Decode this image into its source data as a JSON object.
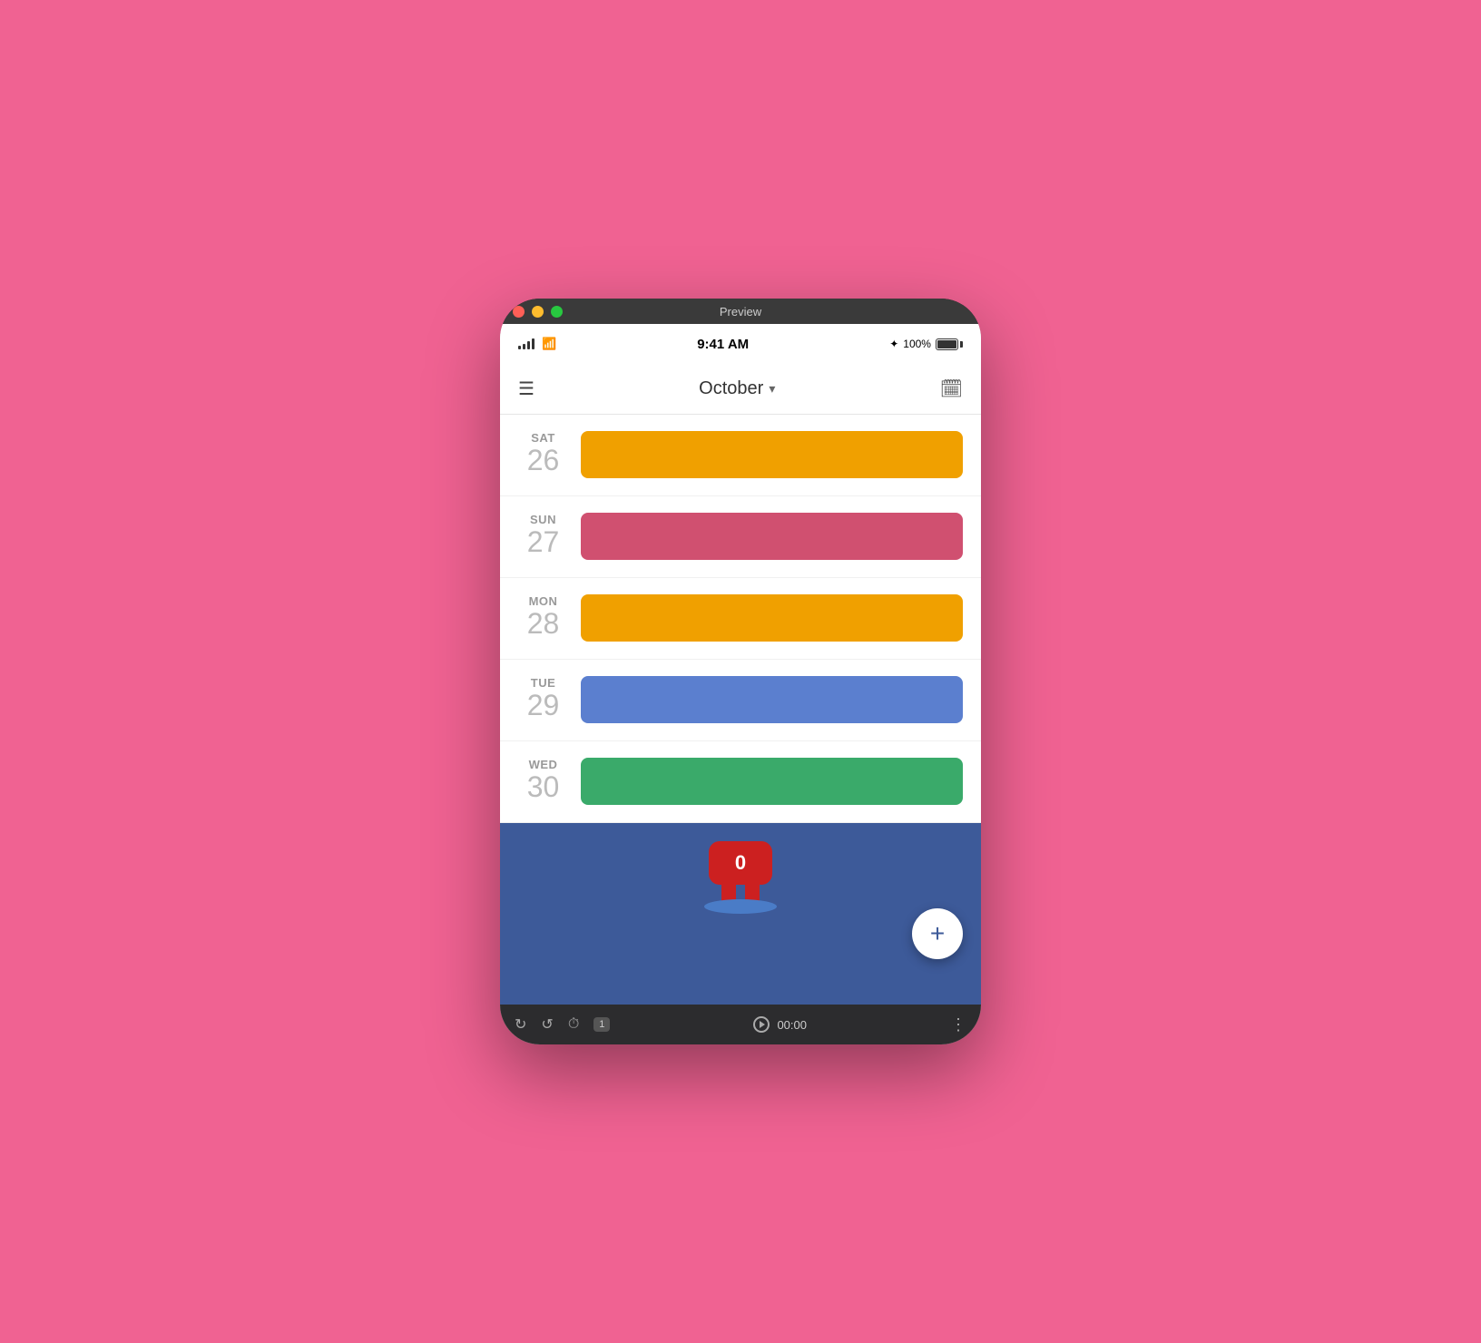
{
  "window": {
    "title": "Preview",
    "mac_buttons": [
      "close",
      "minimize",
      "maximize"
    ]
  },
  "status_bar": {
    "time": "9:41 AM",
    "battery_percent": "100%",
    "bluetooth": "BT"
  },
  "header": {
    "month": "October",
    "hamburger_label": "☰",
    "calendar_icon": "📅",
    "dropdown_arrow": "▾"
  },
  "days": [
    {
      "day_name": "SAT",
      "day_number": "26",
      "event_color": "#f0a000"
    },
    {
      "day_name": "SUN",
      "day_number": "27",
      "event_color": "#d05070"
    },
    {
      "day_name": "MON",
      "day_number": "28",
      "event_color": "#f0a000"
    },
    {
      "day_name": "TUE",
      "day_number": "29",
      "event_color": "#5b7fcf"
    },
    {
      "day_name": "WED",
      "day_number": "30",
      "event_color": "#3aaa6a"
    }
  ],
  "mascot": {
    "badge_count": "0"
  },
  "fab": {
    "label": "+"
  },
  "bottom_toolbar": {
    "timer": "00:00",
    "badge": "1",
    "more_icon": "⋮"
  }
}
